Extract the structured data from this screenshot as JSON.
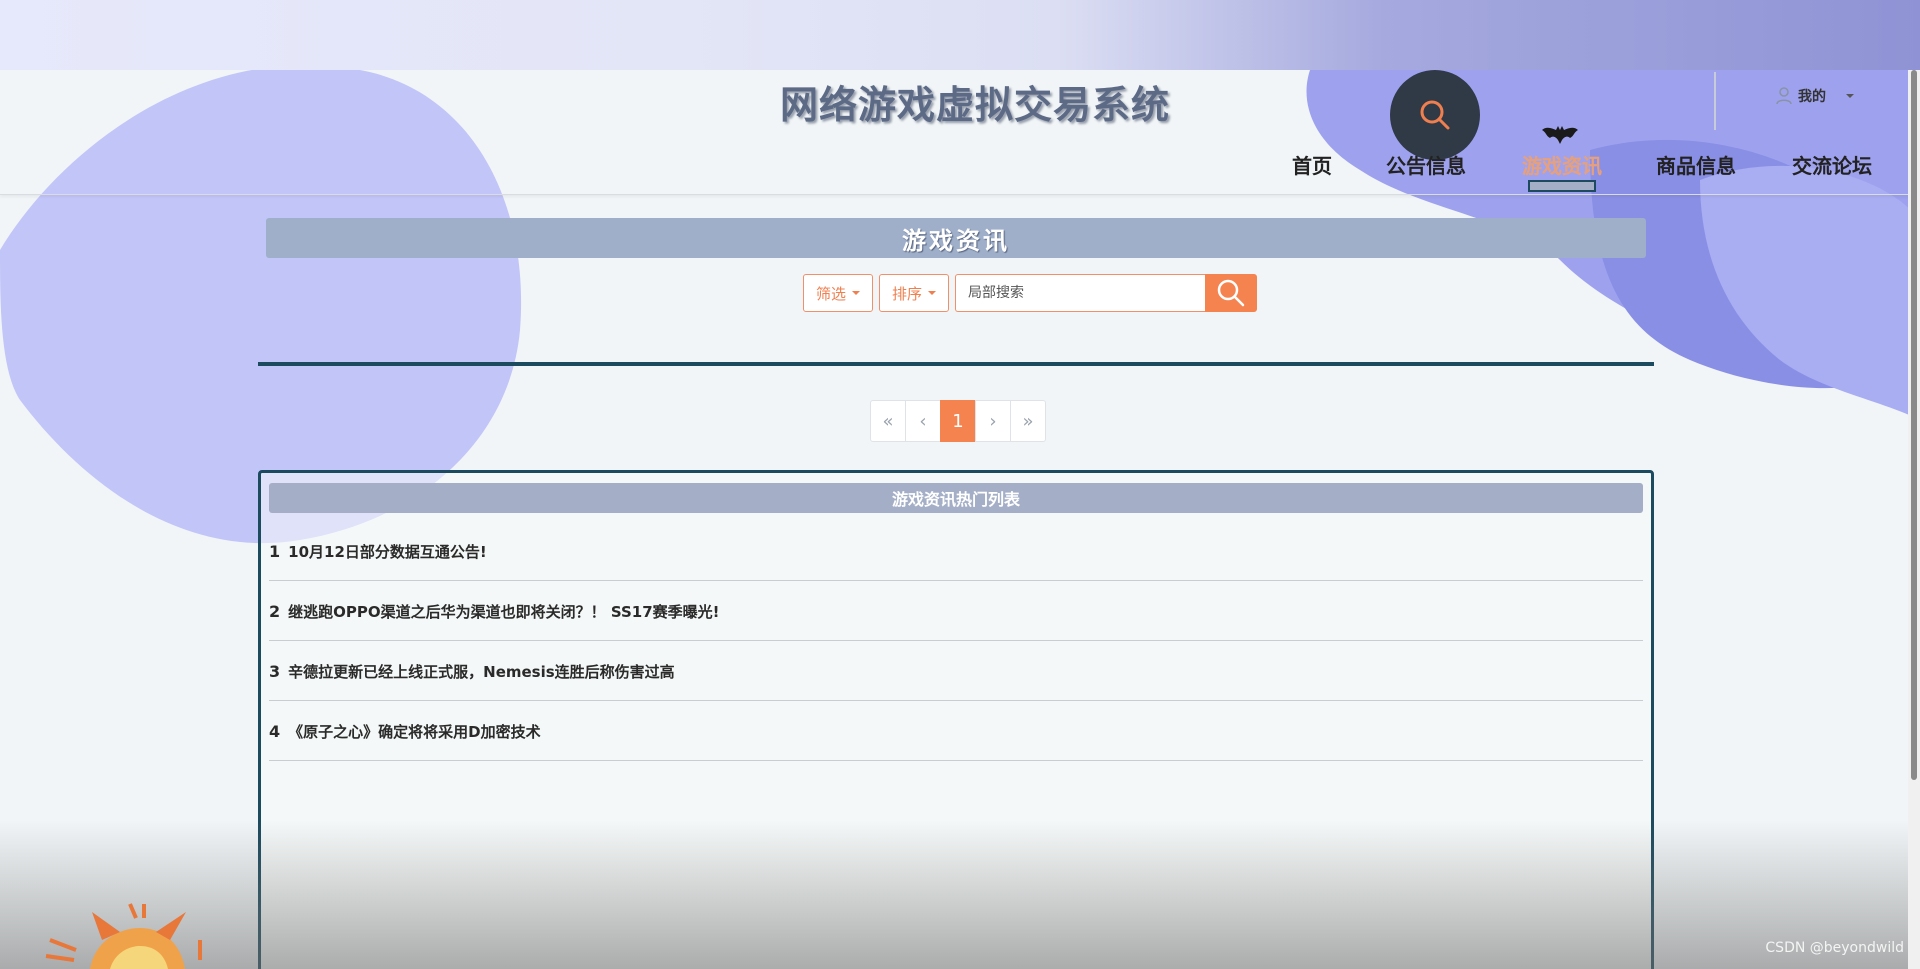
{
  "header": {
    "site_title": "网络游戏虚拟交易系统",
    "user_menu_label": "我的",
    "nav": [
      {
        "label": "首页",
        "active": false
      },
      {
        "label": "公告信息",
        "active": false
      },
      {
        "label": "游戏资讯",
        "active": true
      },
      {
        "label": "商品信息",
        "active": false
      },
      {
        "label": "交流论坛",
        "active": false
      }
    ]
  },
  "page": {
    "heading": "游戏资讯",
    "filter_label": "筛选",
    "sort_label": "排序",
    "search_placeholder": "局部搜索"
  },
  "pagination": {
    "first": "«",
    "prev": "‹",
    "current": "1",
    "next": "›",
    "last": "»"
  },
  "hot_list": {
    "title": "游戏资讯热门列表",
    "items": [
      {
        "rank": "1",
        "title": "10月12日部分数据互通公告!"
      },
      {
        "rank": "2",
        "title": "继逃跑OPPO渠道之后华为渠道也即将关闭？！ SS17赛季曝光!"
      },
      {
        "rank": "3",
        "title": "辛德拉更新已经上线正式服，Nemesis连胜后称伤害过高"
      },
      {
        "rank": "4",
        "title": "《原子之心》确定将将采用D加密技术"
      }
    ]
  },
  "watermark": "CSDN @beyondwild",
  "colors": {
    "accent": "#f5834f",
    "heading_bg": "#9fafc9",
    "dark_rule": "#1c4a5e",
    "blob": "#aeb3f5"
  }
}
